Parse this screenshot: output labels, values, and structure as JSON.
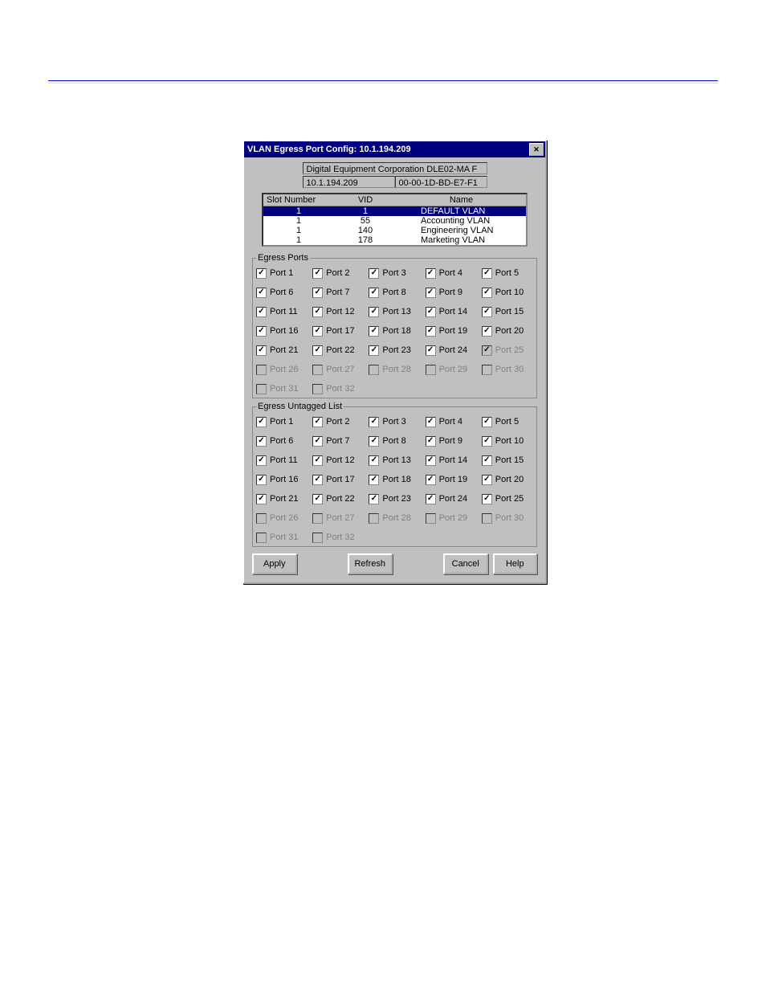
{
  "titlebar": "VLAN Egress Port Config: 10.1.194.209",
  "device_info": {
    "desc": "Digital Equipment Corporation DLE02-MA F",
    "ip": "10.1.194.209",
    "mac": "00-00-1D-BD-E7-F1"
  },
  "columns": {
    "slot": "Slot Number",
    "vid": "VID",
    "name": "Name"
  },
  "vlans": [
    {
      "slot": "1",
      "vid": "1",
      "name": "DEFAULT VLAN",
      "selected": true
    },
    {
      "slot": "1",
      "vid": "55",
      "name": "Accounting VLAN",
      "selected": false
    },
    {
      "slot": "1",
      "vid": "140",
      "name": "Engineering VLAN",
      "selected": false
    },
    {
      "slot": "1",
      "vid": "178",
      "name": "Marketing VLAN",
      "selected": false
    }
  ],
  "groups": {
    "egress_label": "Egress Ports",
    "untagged_label": "Egress Untagged List"
  },
  "egress_ports": [
    {
      "n": 1,
      "checked": true,
      "enabled": true
    },
    {
      "n": 2,
      "checked": true,
      "enabled": true
    },
    {
      "n": 3,
      "checked": true,
      "enabled": true
    },
    {
      "n": 4,
      "checked": true,
      "enabled": true
    },
    {
      "n": 5,
      "checked": true,
      "enabled": true
    },
    {
      "n": 6,
      "checked": true,
      "enabled": true
    },
    {
      "n": 7,
      "checked": true,
      "enabled": true
    },
    {
      "n": 8,
      "checked": true,
      "enabled": true
    },
    {
      "n": 9,
      "checked": true,
      "enabled": true
    },
    {
      "n": 10,
      "checked": true,
      "enabled": true
    },
    {
      "n": 11,
      "checked": true,
      "enabled": true
    },
    {
      "n": 12,
      "checked": true,
      "enabled": true
    },
    {
      "n": 13,
      "checked": true,
      "enabled": true
    },
    {
      "n": 14,
      "checked": true,
      "enabled": true
    },
    {
      "n": 15,
      "checked": true,
      "enabled": true
    },
    {
      "n": 16,
      "checked": true,
      "enabled": true
    },
    {
      "n": 17,
      "checked": true,
      "enabled": true
    },
    {
      "n": 18,
      "checked": true,
      "enabled": true
    },
    {
      "n": 19,
      "checked": true,
      "enabled": true
    },
    {
      "n": 20,
      "checked": true,
      "enabled": true
    },
    {
      "n": 21,
      "checked": true,
      "enabled": true
    },
    {
      "n": 22,
      "checked": true,
      "enabled": true
    },
    {
      "n": 23,
      "checked": true,
      "enabled": true
    },
    {
      "n": 24,
      "checked": true,
      "enabled": true
    },
    {
      "n": 25,
      "checked": true,
      "enabled": false
    },
    {
      "n": 26,
      "checked": false,
      "enabled": false
    },
    {
      "n": 27,
      "checked": false,
      "enabled": false
    },
    {
      "n": 28,
      "checked": false,
      "enabled": false
    },
    {
      "n": 29,
      "checked": false,
      "enabled": false
    },
    {
      "n": 30,
      "checked": false,
      "enabled": false
    },
    {
      "n": 31,
      "checked": false,
      "enabled": false
    },
    {
      "n": 32,
      "checked": false,
      "enabled": false
    }
  ],
  "untagged_ports": [
    {
      "n": 1,
      "checked": true,
      "enabled": true
    },
    {
      "n": 2,
      "checked": true,
      "enabled": true
    },
    {
      "n": 3,
      "checked": true,
      "enabled": true
    },
    {
      "n": 4,
      "checked": true,
      "enabled": true
    },
    {
      "n": 5,
      "checked": true,
      "enabled": true
    },
    {
      "n": 6,
      "checked": true,
      "enabled": true
    },
    {
      "n": 7,
      "checked": true,
      "enabled": true
    },
    {
      "n": 8,
      "checked": true,
      "enabled": true
    },
    {
      "n": 9,
      "checked": true,
      "enabled": true
    },
    {
      "n": 10,
      "checked": true,
      "enabled": true
    },
    {
      "n": 11,
      "checked": true,
      "enabled": true
    },
    {
      "n": 12,
      "checked": true,
      "enabled": true
    },
    {
      "n": 13,
      "checked": true,
      "enabled": true
    },
    {
      "n": 14,
      "checked": true,
      "enabled": true
    },
    {
      "n": 15,
      "checked": true,
      "enabled": true
    },
    {
      "n": 16,
      "checked": true,
      "enabled": true
    },
    {
      "n": 17,
      "checked": true,
      "enabled": true
    },
    {
      "n": 18,
      "checked": true,
      "enabled": true
    },
    {
      "n": 19,
      "checked": true,
      "enabled": true
    },
    {
      "n": 20,
      "checked": true,
      "enabled": true
    },
    {
      "n": 21,
      "checked": true,
      "enabled": true
    },
    {
      "n": 22,
      "checked": true,
      "enabled": true
    },
    {
      "n": 23,
      "checked": true,
      "enabled": true
    },
    {
      "n": 24,
      "checked": true,
      "enabled": true
    },
    {
      "n": 25,
      "checked": true,
      "enabled": true
    },
    {
      "n": 26,
      "checked": false,
      "enabled": false
    },
    {
      "n": 27,
      "checked": false,
      "enabled": false
    },
    {
      "n": 28,
      "checked": false,
      "enabled": false
    },
    {
      "n": 29,
      "checked": false,
      "enabled": false
    },
    {
      "n": 30,
      "checked": false,
      "enabled": false
    },
    {
      "n": 31,
      "checked": false,
      "enabled": false
    },
    {
      "n": 32,
      "checked": false,
      "enabled": false
    }
  ],
  "port_label_prefix": "Port ",
  "buttons": {
    "apply": "Apply",
    "refresh": "Refresh",
    "cancel": "Cancel",
    "help": "Help"
  }
}
